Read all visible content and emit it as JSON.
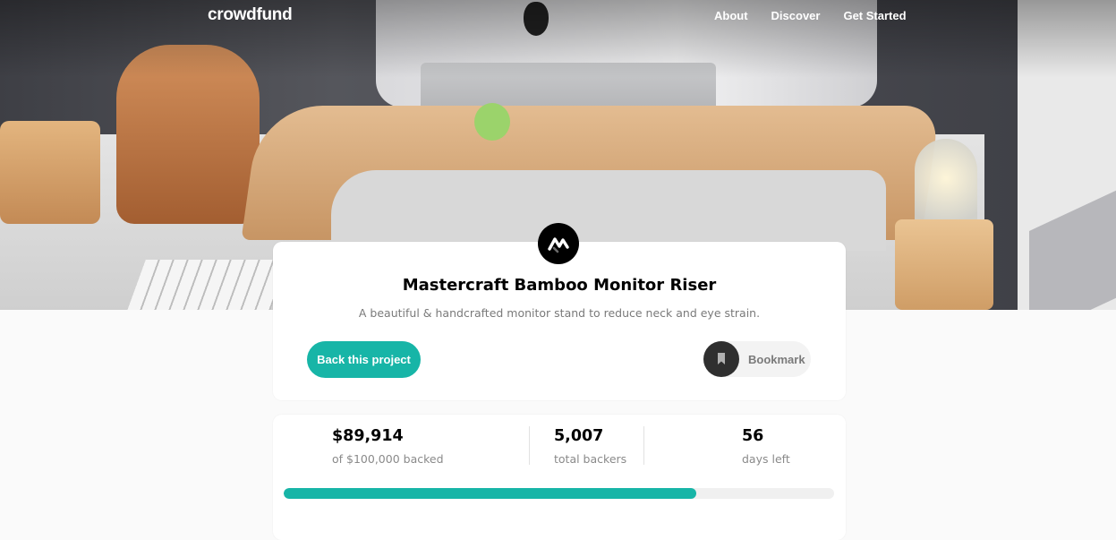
{
  "nav": {
    "logo": "crowdfund",
    "links": [
      "About",
      "Discover",
      "Get Started"
    ]
  },
  "hero": {
    "image": "desk-with-monitor-on-bamboo-riser-photo"
  },
  "project": {
    "logo_icon": "mastercraft-logo-icon",
    "title": "Mastercraft Bamboo Monitor Riser",
    "subtitle": "A beautiful & handcrafted monitor stand to reduce neck and eye strain.",
    "back_label": "Back this project",
    "bookmark_label": "Bookmark",
    "bookmark_icon": "bookmark-icon"
  },
  "stats": {
    "backed_value": "$89,914",
    "backed_label": "of $100,000 backed",
    "backers_value": "5,007",
    "backers_label": "total backers",
    "days_value": "56",
    "days_label": "days left",
    "progress_fraction": 0.75
  },
  "colors": {
    "accent": "#17b5a7",
    "dark": "#2f2f2f",
    "muted": "#7a7a7a",
    "page_bg": "#fafafa"
  }
}
